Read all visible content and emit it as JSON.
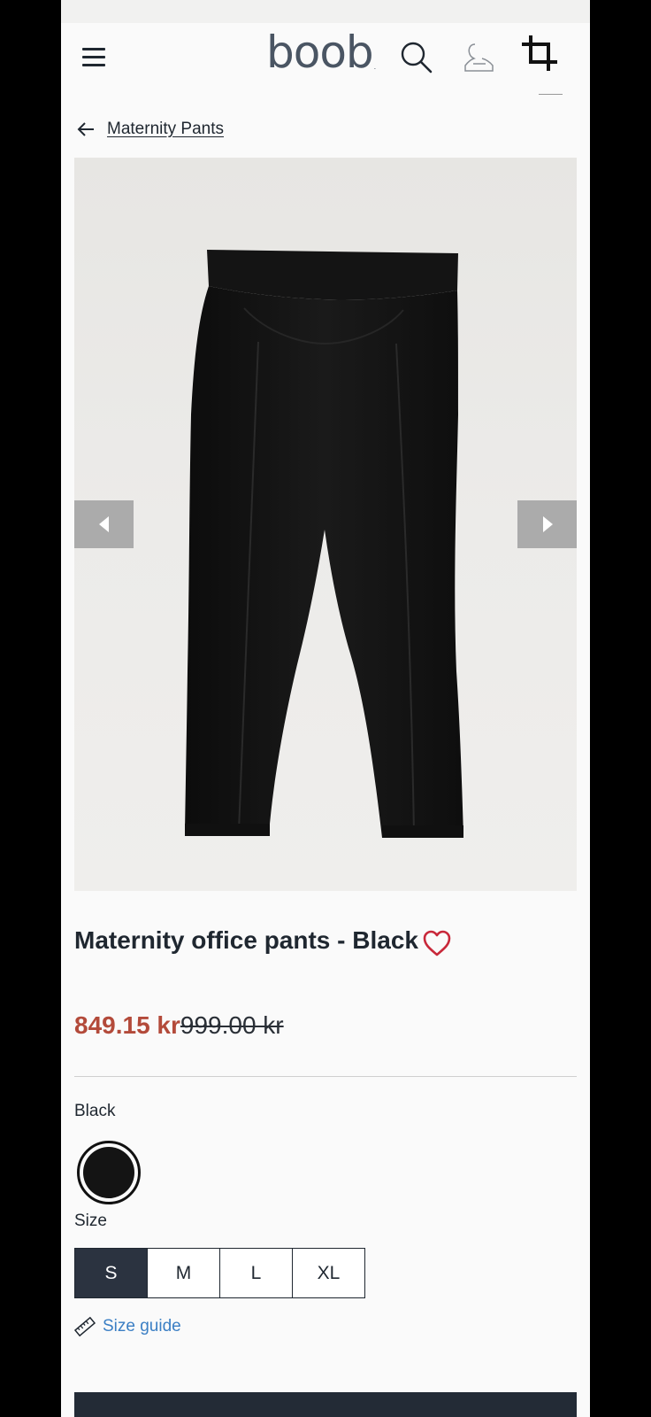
{
  "header": {
    "logo_text": "boob",
    "logo_mark": "."
  },
  "breadcrumb": {
    "back_label": "Maternity Pants"
  },
  "product": {
    "title": "Maternity office pants - Black",
    "price_sale": "849.15 kr",
    "price_original": "999.00 kr",
    "color_label": "Black",
    "size_label": "Size",
    "sizes": [
      "S",
      "M",
      "L",
      "XL"
    ],
    "selected_size": "S",
    "size_guide_label": "Size guide"
  },
  "colors": {
    "accent_sale": "#b34a3a",
    "wishlist": "#c8283a",
    "link": "#3b7fc4",
    "dark": "#2b3340"
  },
  "icons": {
    "menu": "hamburger-icon",
    "search": "search-icon",
    "account": "user-icon",
    "crop": "crop-icon",
    "back": "arrow-left-icon",
    "wishlist": "heart-icon",
    "ruler": "ruler-icon"
  }
}
